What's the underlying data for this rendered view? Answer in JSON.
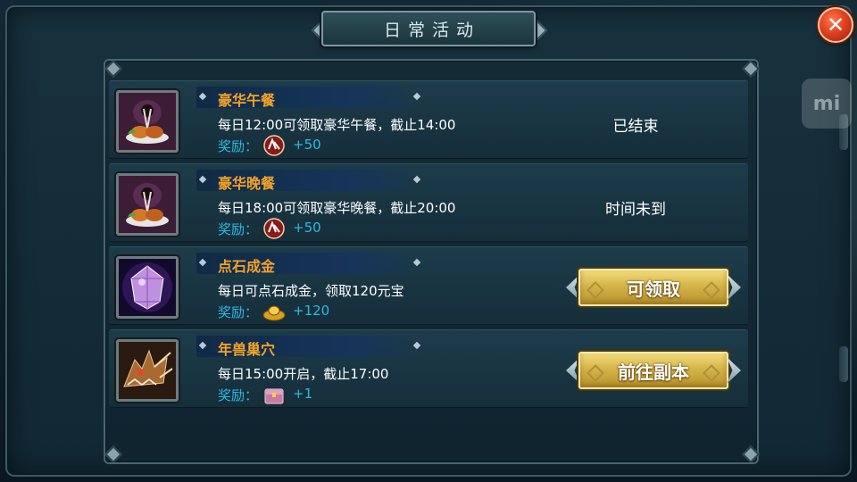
{
  "window": {
    "title": "日常活动",
    "close_icon": "close-icon",
    "side_badge": "mi"
  },
  "activities": [
    {
      "name": "豪华午餐",
      "icon": "feast-icon",
      "description": "每日12:00可领取豪华午餐，截止14:00",
      "reward_label": "奖励：",
      "reward_icon": "stamina-icon",
      "reward_value": "+50",
      "status": "已结束",
      "action_label": ""
    },
    {
      "name": "豪华晚餐",
      "icon": "feast-icon",
      "description": "每日18:00可领取豪华晚餐，截止20:00",
      "reward_label": "奖励：",
      "reward_icon": "stamina-icon",
      "reward_value": "+50",
      "status": "时间未到",
      "action_label": ""
    },
    {
      "name": "点石成金",
      "icon": "purple-gem-icon",
      "description": "每日可点石成金，领取120元宝",
      "reward_label": "奖励：",
      "reward_icon": "gold-ingot-icon",
      "reward_value": "+120",
      "status": "",
      "action_label": "可领取"
    },
    {
      "name": "年兽巢穴",
      "icon": "dragon-beast-icon",
      "description": "每日15:00开启，截止17:00",
      "reward_label": "奖励：",
      "reward_icon": "treasure-box-icon",
      "reward_value": "+1",
      "status": "",
      "action_label": "前往副本"
    }
  ],
  "colors": {
    "activity_name": "#f3a327",
    "reward_text": "#2bb9e6",
    "button_gold": "#d5b44a",
    "close_red": "#e0421f"
  }
}
